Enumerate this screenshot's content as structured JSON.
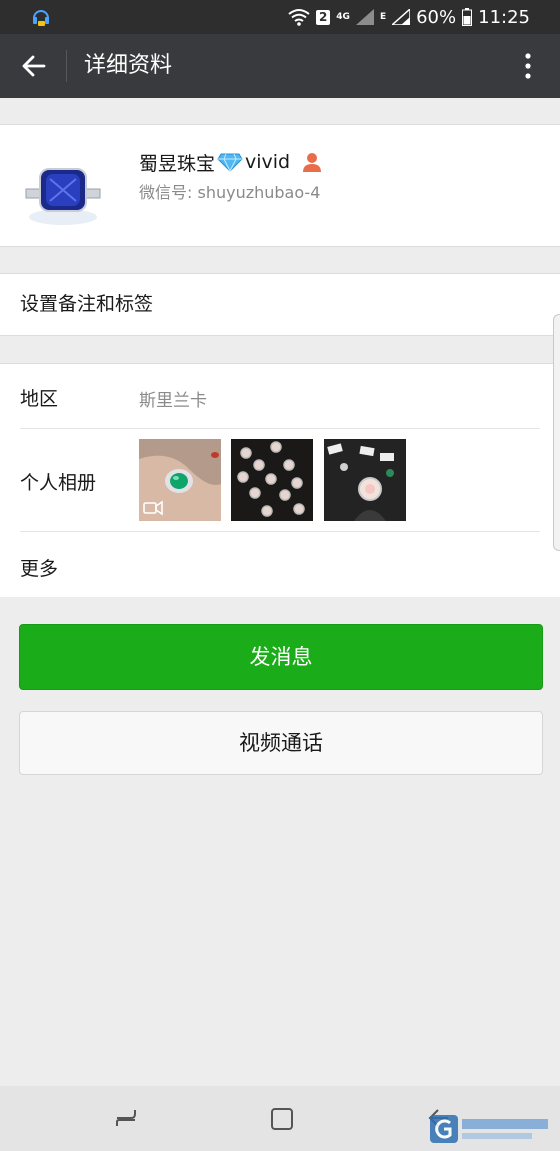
{
  "status_bar": {
    "sim_badge": "2",
    "network_4g": "4G",
    "network_e": "E",
    "battery_percent": "60%",
    "time": "11:25"
  },
  "app_bar": {
    "title": "详细资料"
  },
  "profile": {
    "name_prefix": "蜀昱珠宝",
    "name_suffix": "vivid",
    "wechat_id": "微信号: shuyuzhubao-4"
  },
  "remark": {
    "label": "设置备注和标签"
  },
  "info": {
    "region_label": "地区",
    "region_value": "斯里兰卡",
    "album_label": "个人相册",
    "more_label": "更多"
  },
  "actions": {
    "send_message": "发消息",
    "video_call": "视频通话"
  },
  "colors": {
    "primary_green": "#1aad19",
    "app_bar": "#393a3e",
    "status_bar": "#2e2e2e"
  },
  "icons": {
    "back": "arrow-left-icon",
    "more": "more-vertical-icon",
    "gem": "diamond-icon",
    "person": "person-icon",
    "video": "video-icon"
  }
}
